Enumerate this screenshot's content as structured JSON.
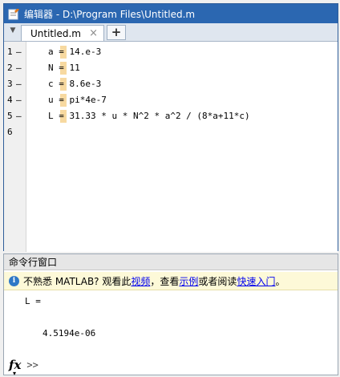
{
  "editor": {
    "title": "编辑器 - D:\\Program Files\\Untitled.m",
    "tab_label": "Untitled.m",
    "tab_close": "×",
    "new_tab": "+",
    "dropdown_glyph": "▼",
    "lines": [
      {
        "num": "1",
        "dash": "–",
        "code": "a = 14.e-3"
      },
      {
        "num": "2",
        "dash": "–",
        "code": "N = 11"
      },
      {
        "num": "3",
        "dash": "–",
        "code": "c = 8.6e-3"
      },
      {
        "num": "4",
        "dash": "–",
        "code": "u = pi*4e-7"
      },
      {
        "num": "5",
        "dash": "–",
        "code": "L = 31.33 * u * N^2 * a^2 / (8*a+11*c)"
      },
      {
        "num": "6",
        "dash": "",
        "code": ""
      }
    ]
  },
  "command_window": {
    "header": "命令行窗口",
    "info_prefix": "不熟悉 MATLAB? 观看此",
    "link_video": "视频",
    "info_mid": "，查看",
    "link_example": "示例",
    "info_mid2": "或者阅读",
    "link_quickstart": "快速入门",
    "info_suffix": "。",
    "output_var": "L =",
    "output_value": "4.5194e-06",
    "fx": "fx",
    "caret": "▾",
    "prompt": ">>"
  }
}
